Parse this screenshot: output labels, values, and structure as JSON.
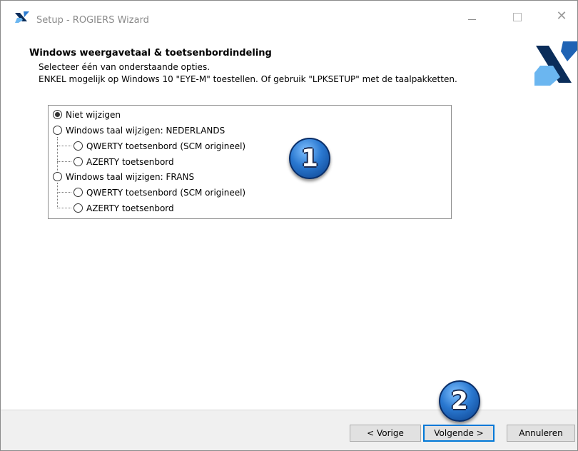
{
  "window": {
    "title": "Setup - ROGIERS Wizard",
    "icons": {
      "app": "rogiers-logo-icon",
      "minimize": "minimize-icon",
      "maximize": "maximize-icon",
      "close": "close-icon"
    }
  },
  "header": {
    "title": "Windows weergavetaal & toetsenbordindeling",
    "subtitle": "Selecteer één van onderstaande opties.",
    "note": "ENKEL mogelijk op Windows 10 \"EYE-M\" toestellen. Of gebruik \"LPKSETUP\" met de taalpakketten."
  },
  "options": [
    {
      "label": "Niet wijzigen",
      "checked": true
    },
    {
      "label": "Windows taal wijzigen: NEDERLANDS",
      "checked": false
    },
    {
      "label": "QWERTY toetsenbord (SCM origineel)",
      "checked": false
    },
    {
      "label": "AZERTY toetsenbord",
      "checked": false
    },
    {
      "label": "Windows taal wijzigen: FRANS",
      "checked": false
    },
    {
      "label": "QWERTY toetsenbord (SCM origineel)",
      "checked": false
    },
    {
      "label": "AZERTY toetsenbord",
      "checked": false
    }
  ],
  "badges": {
    "first": "1",
    "second": "2"
  },
  "buttons": {
    "prev": "< Vorige",
    "next": "Volgende >",
    "cancel": "Annuleren"
  },
  "colors": {
    "accent": "#0078d7",
    "logo_dark": "#0b2d5a",
    "logo_light": "#4aa3e8"
  }
}
